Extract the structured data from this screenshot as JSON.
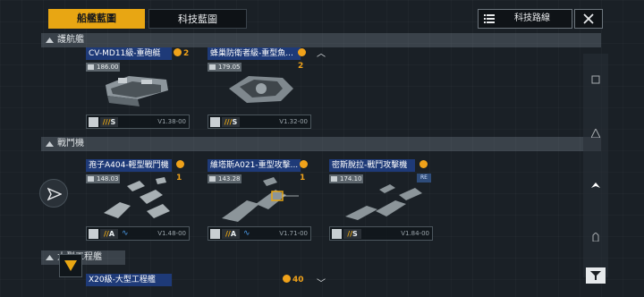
{
  "tabs": {
    "ships": "船艦藍圖",
    "tech": "科技藍圖"
  },
  "toolbar": {
    "tech_route": "科技路線"
  },
  "sections": {
    "escort": "護航艦",
    "fighter": "戰鬥機",
    "large": "大型工程艦"
  },
  "cards": [
    {
      "title": "CV-MD11級-重砲艇",
      "count": "2",
      "stat": "186.00",
      "rank": "S",
      "version": "V1.38-00",
      "has_wave": false
    },
    {
      "title": "蜂巢防衛者級-重型魚...",
      "count": "2",
      "stat": "179.05",
      "rank": "S",
      "version": "V1.32-00",
      "has_wave": false
    },
    {
      "title": "孢子A404-輕型戰鬥機",
      "count": "1",
      "stat": "148.03",
      "rank": "A",
      "version": "V1.48-00",
      "has_wave": true
    },
    {
      "title": "維塔斯A021-重型攻擊...",
      "count": "1",
      "stat": "143.28",
      "rank": "A",
      "version": "V1.71-00",
      "has_wave": true
    },
    {
      "title": "密斯脫拉-戰鬥攻擊機",
      "count": "1",
      "stat": "174.10",
      "rank": "S",
      "version": "V1.84-00",
      "has_wave": false
    },
    {
      "title": "X20級-大型工程艦",
      "count": "40",
      "stat": "",
      "rank": "",
      "version": "",
      "has_wave": false
    }
  ],
  "tags": {
    "re": "RE"
  },
  "colors": {
    "accent": "#e8a613",
    "title_bg": "#1e3a78",
    "background": "#1a2026"
  },
  "icons": [
    "list-icon",
    "close-icon",
    "chevron-up-icon",
    "chevron-down-icon",
    "filter-icon",
    "paper-plane-icon",
    "medal-icon"
  ]
}
